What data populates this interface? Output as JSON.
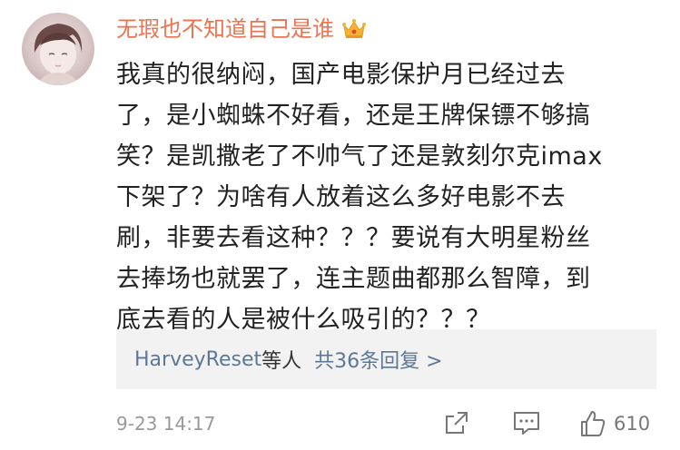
{
  "user": {
    "name": "无瑕也不知道自己是谁",
    "badge_icon": "crown-icon"
  },
  "comment": {
    "lines": [
      "我真的很纳闷，国产电影保护月已经过去",
      "了，是小蜘蛛不好看，还是王牌保镖不够搞",
      "笑？是凯撒老了不帅气了还是敦刻尔克imax",
      "下架了？为啥有人放着这么多好电影不去",
      "刷，非要去看这种？？？要说有大明星粉丝",
      "去捧场也就罢了，连主题曲都那么智障，到",
      "底去看的人是被什么吸引的？？？"
    ]
  },
  "replies": {
    "users": "HarveyReset",
    "suffix": "等人",
    "count_label": "共36条回复 >"
  },
  "footer": {
    "timestamp": "9-23 14:17",
    "like_count": "610"
  },
  "colors": {
    "username": "#eb7350",
    "link": "#5d7895",
    "text": "#222222",
    "meta": "#999999",
    "reply_bg": "#f2f2f2"
  }
}
